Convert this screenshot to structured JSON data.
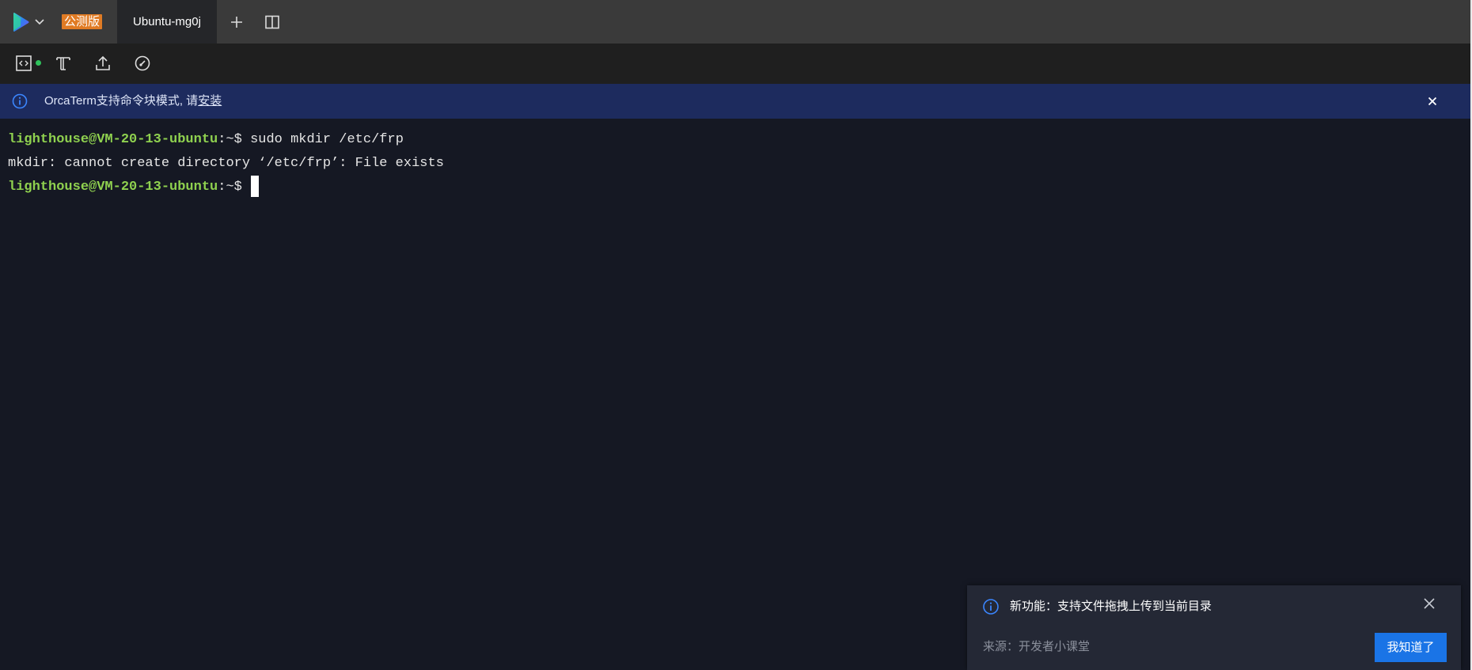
{
  "topbar": {
    "logo_icon": "orcaterm-logo-icon",
    "beta_badge": "公测版",
    "tab_label": "Ubuntu-mg0j",
    "icons": [
      "chevron-down-icon",
      "plus-icon",
      "split-panel-icon"
    ]
  },
  "toolbar": {
    "icons": [
      "code-panel-icon",
      "text-font-icon",
      "upload-icon",
      "gauge-icon"
    ],
    "status_color": "#2fc25b"
  },
  "banner": {
    "text_prefix": "OrcaTerm支持命令块模式, 请",
    "link_text": "安装"
  },
  "terminal": {
    "lines": [
      {
        "user_host": "lighthouse@VM-20-13-ubuntu",
        "path_prompt": ":~$ ",
        "command": "sudo mkdir /etc/frp"
      },
      {
        "output": "mkdir: cannot create directory ‘/etc/frp’: File exists"
      },
      {
        "user_host": "lighthouse@VM-20-13-ubuntu",
        "path_prompt": ":~$"
      }
    ]
  },
  "toast": {
    "title": "新功能：支持文件拖拽上传到当前目录",
    "source": "来源：开发者小课堂",
    "button_label": "我知道了"
  },
  "colors": {
    "accent": "#1a74e6",
    "badge": "#e07b24",
    "prompt_user": "#8fd14f",
    "banner_bg": "#1d2b5e"
  }
}
